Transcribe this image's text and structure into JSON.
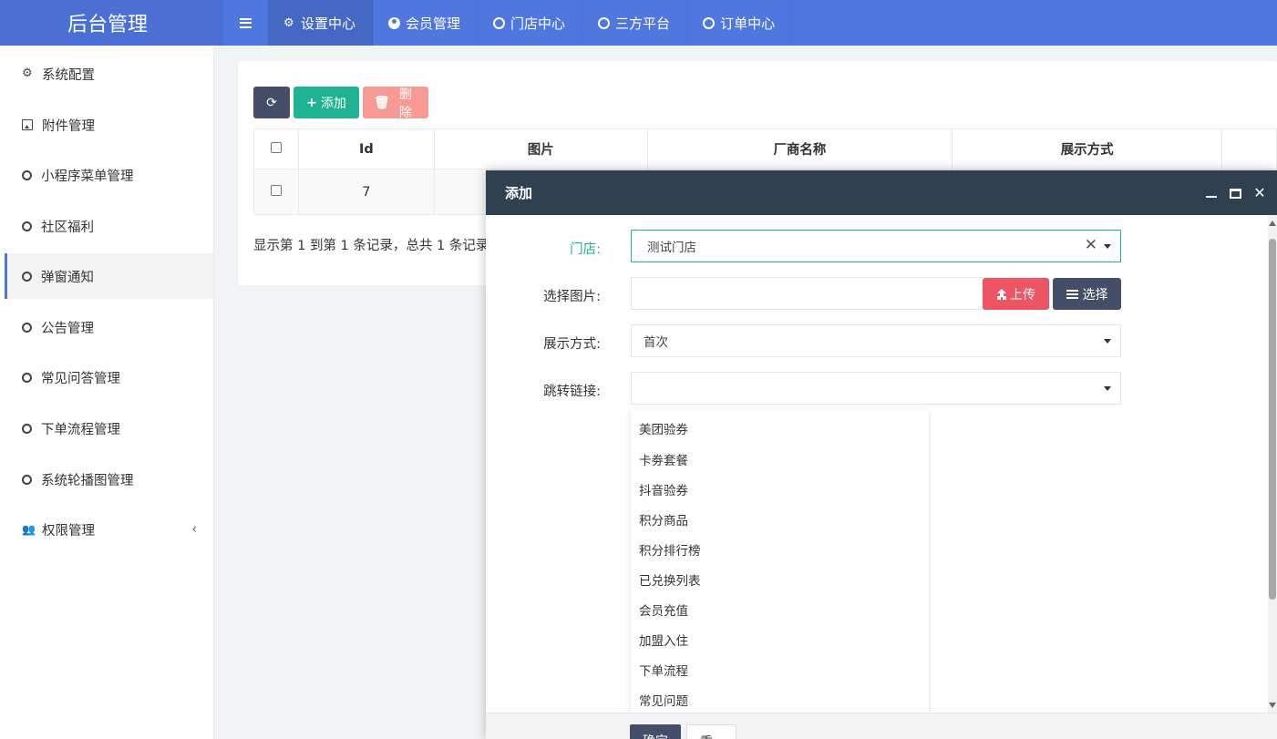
{
  "header": {
    "brand": "后台管理",
    "nav": [
      {
        "label": "设置中心",
        "icon": "gears-icon"
      },
      {
        "label": "会员管理",
        "icon": "user-circle-icon"
      },
      {
        "label": "门店中心",
        "icon": "circle-icon"
      },
      {
        "label": "三方平台",
        "icon": "circle-icon"
      },
      {
        "label": "订单中心",
        "icon": "circle-icon"
      }
    ]
  },
  "sidebar": {
    "items": [
      {
        "label": "系统配置",
        "icon": "gear-icon"
      },
      {
        "label": "附件管理",
        "icon": "image-icon"
      },
      {
        "label": "小程序菜单管理",
        "icon": "circle-icon"
      },
      {
        "label": "社区福利",
        "icon": "circle-icon"
      },
      {
        "label": "弹窗通知",
        "icon": "circle-icon"
      },
      {
        "label": "公告管理",
        "icon": "circle-icon"
      },
      {
        "label": "常见问答管理",
        "icon": "circle-icon"
      },
      {
        "label": "下单流程管理",
        "icon": "circle-icon"
      },
      {
        "label": "系统轮播图管理",
        "icon": "circle-icon"
      },
      {
        "label": "权限管理",
        "icon": "users-icon"
      }
    ],
    "collapse_arrow": "‹"
  },
  "toolbar": {
    "add_label": "添加",
    "delete_label": "删除"
  },
  "table": {
    "headers": [
      "Id",
      "图片",
      "厂商名称",
      "展示方式"
    ],
    "rows": [
      [
        "7"
      ]
    ]
  },
  "pager": {
    "text": "显示第 1 到第 1 条记录，总共 1 条记录"
  },
  "modal": {
    "title": "添加",
    "fields": {
      "store_label": "门店:",
      "store_value": "测试门店",
      "image_label": "选择图片:",
      "upload_label": "上传",
      "choose_label": "选择",
      "display_label": "展示方式:",
      "display_value": "首次",
      "link_label": "跳转链接:",
      "link_value": ""
    },
    "dropdown_options": [
      "美团验券",
      "卡劵套餐",
      "抖音验券",
      "积分商品",
      "积分排行榜",
      "已兑换列表",
      "会员充值",
      "加盟入住",
      "下单流程",
      "常见问题"
    ],
    "confirm_label": "确定",
    "reset_label": "重置"
  }
}
